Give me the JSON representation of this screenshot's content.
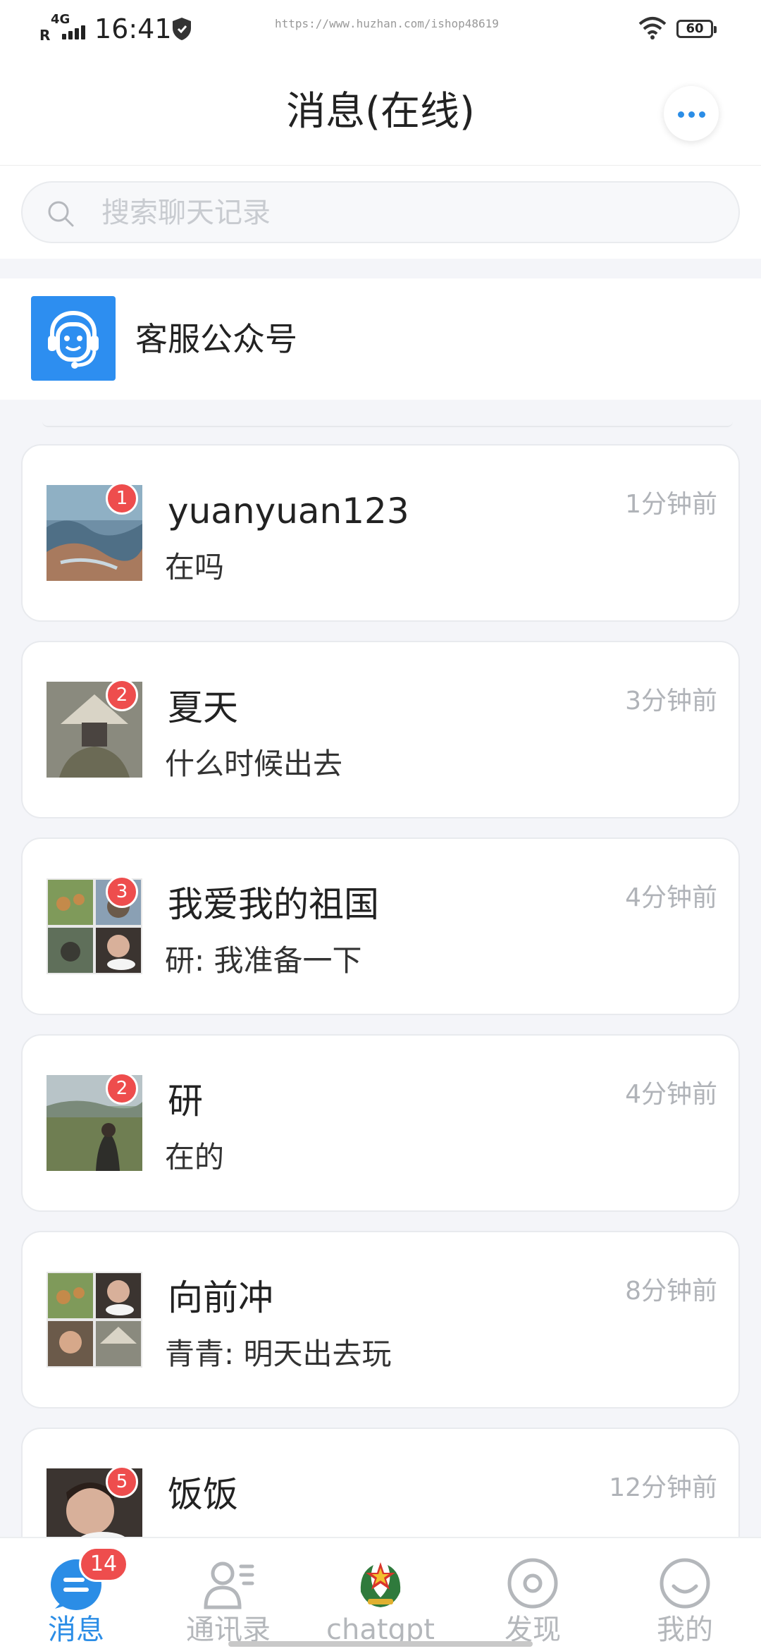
{
  "statusbar": {
    "network": "4G",
    "roaming": "R",
    "time": "16:41",
    "url": "https://www.huzhan.com/ishop48619",
    "battery": "60"
  },
  "header": {
    "title": "消息(在线)"
  },
  "search": {
    "placeholder": "搜索聊天记录",
    "value": ""
  },
  "service": {
    "name": "客服公众号",
    "icon": "customer-service-icon",
    "color": "#2d8ef0"
  },
  "chats": [
    {
      "name": "yuanyuan123",
      "message": "在吗",
      "time": "1分钟前",
      "unread": "1",
      "avatar": "sea-photo"
    },
    {
      "name": "夏天",
      "message": "什么时候出去",
      "time": "3分钟前",
      "unread": "2",
      "avatar": "straw-hat-photo"
    },
    {
      "name": "我爱我的祖国",
      "message": "研: 我准备一下",
      "time": "4分钟前",
      "unread": "3",
      "avatar": "group-grid"
    },
    {
      "name": "研",
      "message": "在的",
      "time": "4分钟前",
      "unread": "2",
      "avatar": "field-photo"
    },
    {
      "name": "向前冲",
      "message": "青青: 明天出去玩",
      "time": "8分钟前",
      "unread": "",
      "avatar": "group-grid"
    },
    {
      "name": "饭饭",
      "message": "",
      "time": "12分钟前",
      "unread": "5",
      "avatar": "child-photo"
    }
  ],
  "tabs": [
    {
      "label": "消息",
      "icon": "message-icon",
      "badge": "14",
      "active": true
    },
    {
      "label": "通讯录",
      "icon": "contacts-icon",
      "badge": "",
      "active": false
    },
    {
      "label": "chatgpt",
      "icon": "emblem-icon",
      "badge": "",
      "active": false
    },
    {
      "label": "发现",
      "icon": "discover-icon",
      "badge": "",
      "active": false
    },
    {
      "label": "我的",
      "icon": "profile-icon",
      "badge": "",
      "active": false
    }
  ],
  "colors": {
    "accent": "#2b8de6",
    "badge": "#ee4d4d",
    "background": "#f4f5f9"
  }
}
